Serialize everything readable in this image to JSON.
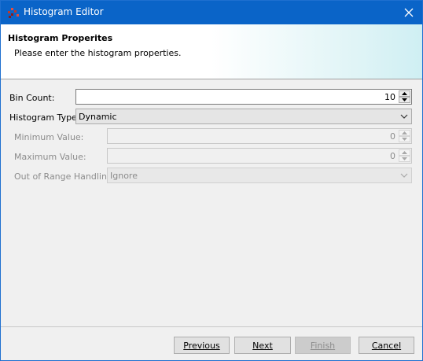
{
  "window": {
    "title": "Histogram Editor",
    "accent_color": "#0a64c8",
    "icon": "histogram-app-icon"
  },
  "header": {
    "title": "Histogram Properites",
    "subtitle": "Please enter the histogram properties."
  },
  "form": {
    "bin_count": {
      "label": "Bin Count:",
      "value": "10"
    },
    "histogram_type": {
      "label": "Histogram Type:",
      "value": "Dynamic"
    },
    "minimum_value": {
      "label": "Minimum Value:",
      "value": "0"
    },
    "maximum_value": {
      "label": "Maximum Value:",
      "value": "0"
    },
    "out_of_range": {
      "label": "Out of Range Handling:",
      "value": "Ignore"
    }
  },
  "buttons": {
    "previous": "Previous",
    "next": "Next",
    "finish": "Finish",
    "cancel": "Cancel"
  }
}
